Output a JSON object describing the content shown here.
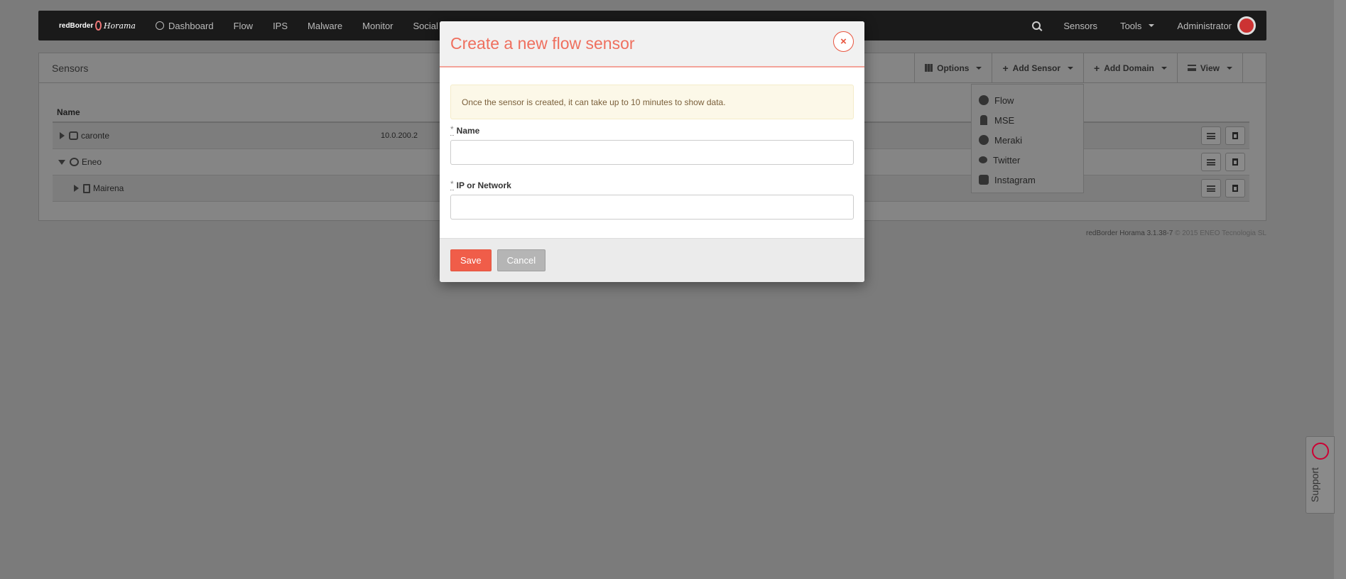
{
  "navbar": {
    "brand_main": "redBorder",
    "brand_sub": "Horama",
    "items": [
      {
        "label": "Dashboard"
      },
      {
        "label": "Flow"
      },
      {
        "label": "IPS"
      },
      {
        "label": "Malware"
      },
      {
        "label": "Monitor"
      },
      {
        "label": "Social"
      }
    ],
    "right": {
      "sensors": "Sensors",
      "tools": "Tools",
      "user": "Administrator"
    }
  },
  "panel": {
    "title": "Sensors",
    "actions": {
      "options": "Options",
      "add_sensor": "Add Sensor",
      "add_domain": "Add Domain",
      "view": "View"
    },
    "table": {
      "header_name": "Name",
      "rows": [
        {
          "name": "caronte",
          "ip": "10.0.200.2"
        },
        {
          "name": "Eneo",
          "ip": ""
        },
        {
          "name": "Mairena",
          "ip": ""
        }
      ]
    }
  },
  "add_sensor_menu": {
    "items": [
      {
        "label": "Flow",
        "icon": "flow-icon"
      },
      {
        "label": "MSE",
        "icon": "mse-icon"
      },
      {
        "label": "Meraki",
        "icon": "meraki-icon"
      },
      {
        "label": "Twitter",
        "icon": "twitter-icon"
      },
      {
        "label": "Instagram",
        "icon": "instagram-icon"
      }
    ]
  },
  "footer": {
    "version": "redBorder Horama 3.1.38-7",
    "copyright": "© 2015 ENEO Tecnologia SL"
  },
  "support": {
    "label": "Support"
  },
  "modal": {
    "title": "Create a new flow sensor",
    "close_glyph": "×",
    "alert": "Once the sensor is created, it can take up to 10 minutes to show data.",
    "required_mark": "*",
    "name_label": "Name",
    "name_value": "",
    "ip_label": "IP or Network",
    "ip_value": "",
    "save_label": "Save",
    "cancel_label": "Cancel"
  },
  "colors": {
    "accent": "#ef6f5e",
    "save_button": "#f05d49",
    "cancel_button": "#b5b5b5",
    "alert_bg": "#fcf8e8",
    "overlay": "#7b7b7b"
  }
}
